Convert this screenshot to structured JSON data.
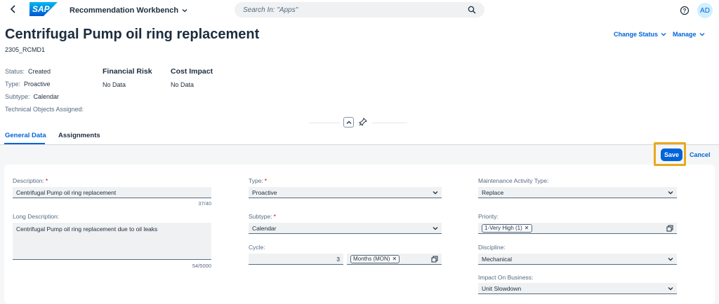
{
  "shell": {
    "logo": "SAP",
    "app_title": "Recommendation Workbench",
    "search_placeholder": "Search In: \"Apps\"",
    "user_initials": "AD"
  },
  "header": {
    "title": "Centrifugal Pump oil ring replacement",
    "subtitle": "2305_RCMD1",
    "actions": {
      "change_status": "Change Status",
      "manage": "Manage"
    },
    "attributes": {
      "status_label": "Status:",
      "status_value": "Created",
      "type_label": "Type:",
      "type_value": "Proactive",
      "subtype_label": "Subtype:",
      "subtype_value": "Calendar",
      "tech_objects_label": "Technical Objects Assigned:"
    },
    "facets": {
      "financial_risk_title": "Financial Risk",
      "financial_risk_value": "No Data",
      "cost_impact_title": "Cost Impact",
      "cost_impact_value": "No Data"
    }
  },
  "tabs": [
    {
      "label": "General Data",
      "active": true
    },
    {
      "label": "Assignments",
      "active": false
    }
  ],
  "toolbar": {
    "save_label": "Save",
    "cancel_label": "Cancel"
  },
  "form": {
    "description": {
      "label": "Description:",
      "value": "Centrifugal Pump oil ring replacement",
      "counter": "37/40"
    },
    "long_description": {
      "label": "Long Description:",
      "value": "Centrifugal Pump oil ring replacement due to oil leaks",
      "counter": "54/5000"
    },
    "type": {
      "label": "Type:",
      "value": "Proactive"
    },
    "subtype": {
      "label": "Subtype:",
      "value": "Calendar"
    },
    "cycle": {
      "label": "Cycle:",
      "value": "3",
      "unit_token": "Months (MON)"
    },
    "maintenance_activity_type": {
      "label": "Maintenance Activity Type:",
      "value": "Replace"
    },
    "priority": {
      "label": "Priority:",
      "token": "1-Very High (1)"
    },
    "discipline": {
      "label": "Discipline:",
      "value": "Mechanical"
    },
    "impact_on_business": {
      "label": "Impact On Business:",
      "value": "Unit Slowdown"
    }
  },
  "colors": {
    "accent": "#0064d9",
    "highlight": "#e8a920",
    "required": "#aa0808"
  }
}
